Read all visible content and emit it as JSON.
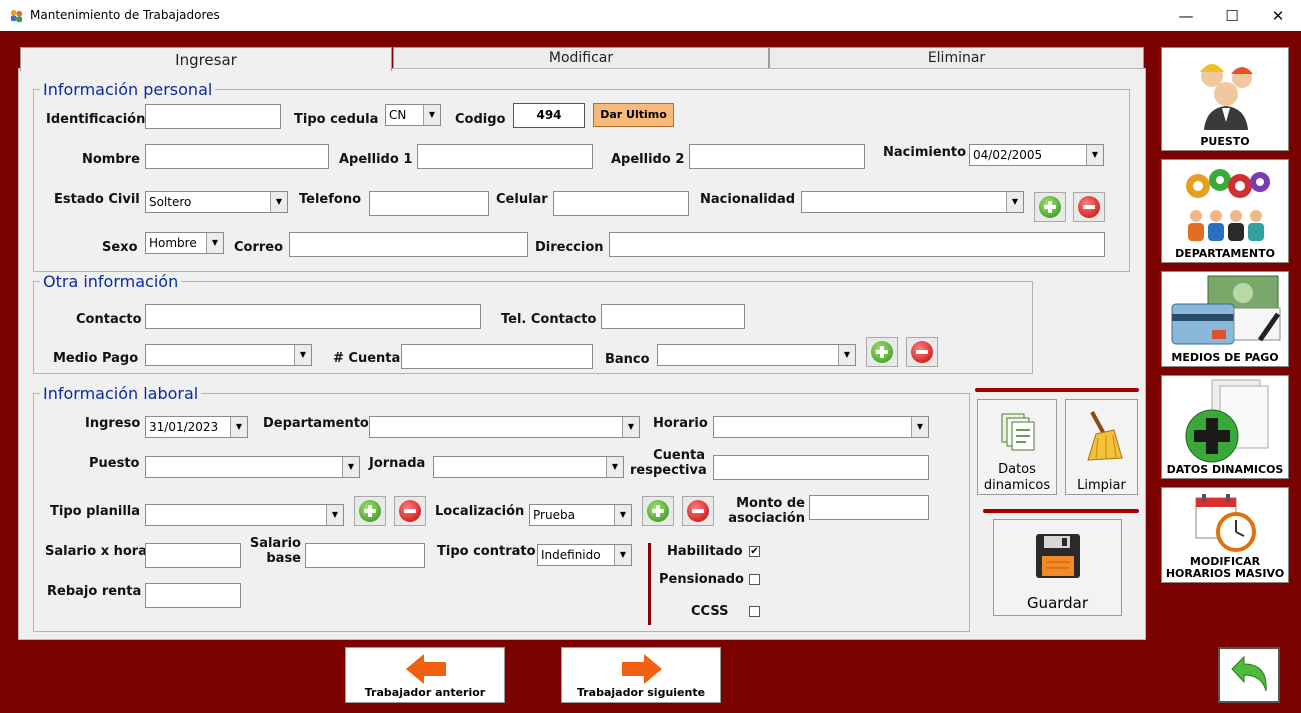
{
  "window": {
    "title": "Mantenimiento de Trabajadores",
    "minimize": "—",
    "maximize": "☐",
    "close": "✕"
  },
  "tabs": [
    {
      "label": "Ingresar"
    },
    {
      "label": "Modificar"
    },
    {
      "label": "Eliminar"
    }
  ],
  "personal": {
    "legend": "Información personal",
    "identificacion_label": "Identificación",
    "identificacion_value": "",
    "tipo_cedula_label": "Tipo cedula",
    "tipo_cedula_value": "CN",
    "codigo_label": "Codigo",
    "codigo_value": "494",
    "dar_ultimo_label": "Dar Ultimo",
    "nombre_label": "Nombre",
    "apellido1_label": "Apellido 1",
    "apellido2_label": "Apellido 2",
    "nacimiento_label": "Nacimiento",
    "nacimiento_value": "04/02/2005",
    "estado_civil_label": "Estado Civil",
    "estado_civil_value": "Soltero",
    "telefono_label": "Telefono",
    "celular_label": "Celular",
    "nacionalidad_label": "Nacionalidad",
    "sexo_label": "Sexo",
    "sexo_value": "Hombre",
    "correo_label": "Correo",
    "direccion_label": "Direccion"
  },
  "otra": {
    "legend": "Otra información",
    "contacto_label": "Contacto",
    "tel_contacto_label": "Tel. Contacto",
    "medio_pago_label": "Medio Pago",
    "cuenta_label": "# Cuenta",
    "banco_label": "Banco"
  },
  "laboral": {
    "legend": "Información laboral",
    "ingreso_label": "Ingreso",
    "ingreso_value": "31/01/2023",
    "departamento_label": "Departamento",
    "horario_label": "Horario",
    "puesto_label": "Puesto",
    "jornada_label": "Jornada",
    "cuenta_respectiva_label_1": "Cuenta",
    "cuenta_respectiva_label_2": "respectiva",
    "tipo_planilla_label": "Tipo planilla",
    "localizacion_label": "Localización",
    "localizacion_value": "Prueba",
    "monto_label_1": "Monto de",
    "monto_label_2": "asociación",
    "salario_hora_label": "Salario x hora",
    "salario_base_label_1": "Salario",
    "salario_base_label_2": "base",
    "tipo_contrato_label": "Tipo contrato",
    "tipo_contrato_value": "Indefinido",
    "rebajo_renta_label": "Rebajo renta",
    "habilitado_label": "Habilitado",
    "habilitado_checked": "✔",
    "pensionado_label": "Pensionado",
    "ccss_label": "CCSS"
  },
  "actions": {
    "datos_dinamicos_1": "Datos",
    "datos_dinamicos_2": "dinamicos",
    "limpiar": "Limpiar",
    "guardar": "Guardar"
  },
  "sidebar": [
    {
      "label": "PUESTO"
    },
    {
      "label": "DEPARTAMENTO"
    },
    {
      "label": "MEDIOS DE PAGO"
    },
    {
      "label": "DATOS DINAMICOS"
    },
    {
      "label_1": "MODIFICAR",
      "label_2": "HORARIOS MASIVO"
    }
  ],
  "nav": {
    "anterior": "Trabajador anterior",
    "siguiente": "Trabajador siguiente"
  },
  "colors": {
    "background": "#7b0000",
    "panel": "#f0f0f0",
    "legend": "#0a2b9e",
    "accent_button": "#f7b97a"
  }
}
